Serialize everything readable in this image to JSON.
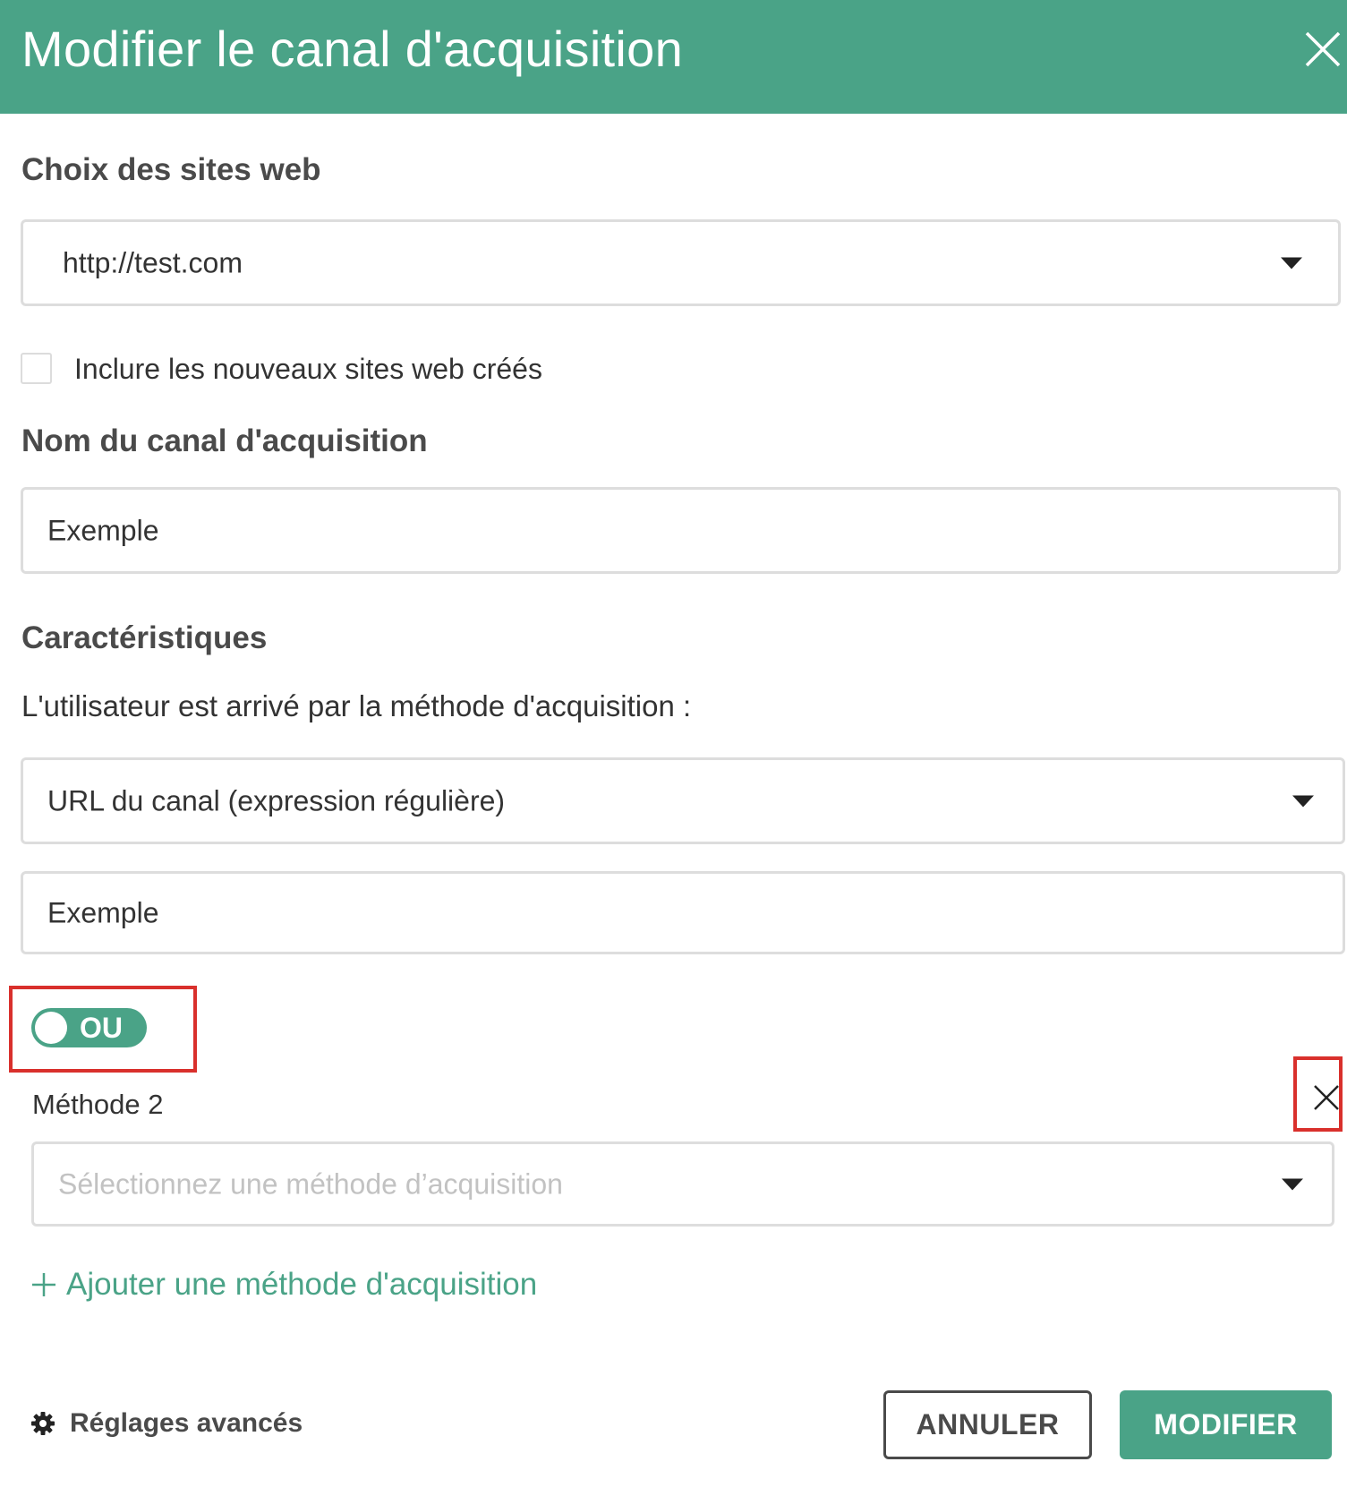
{
  "dialog": {
    "title": "Modifier le canal d'acquisition"
  },
  "websites": {
    "section_title": "Choix des sites web",
    "selected": "http://test.com",
    "include_new_label": "Inclure les nouveaux sites web créés",
    "include_new_checked": false
  },
  "channel_name": {
    "section_title": "Nom du canal d'acquisition",
    "value": "Exemple"
  },
  "characteristics": {
    "section_title": "Caractéristiques",
    "description": "L'utilisateur est arrivé par la méthode d'acquisition :",
    "method1": {
      "selected": "URL du canal (expression régulière)",
      "value": "Exemple"
    },
    "operator_toggle": "OU",
    "method2": {
      "label": "Méthode 2",
      "placeholder": "Sélectionnez une méthode d’acquisition"
    },
    "add_method_label": "Ajouter une méthode d'acquisition"
  },
  "footer": {
    "advanced_label": "Réglages avancés",
    "cancel_label": "ANNULER",
    "submit_label": "MODIFIER"
  },
  "colors": {
    "brand_green": "#4aa387",
    "highlight_red": "#d9302c"
  },
  "icons": {
    "close": "close-icon",
    "caret": "caret-down-icon",
    "plus": "plus-icon",
    "gear": "gear-icon"
  }
}
